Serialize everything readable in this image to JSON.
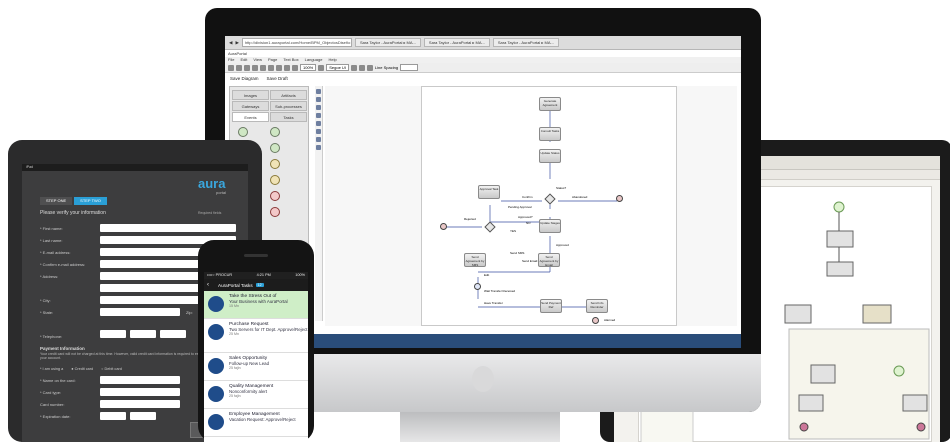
{
  "laptop": {
    "toolbar_label": "Line Spacing"
  },
  "monitor": {
    "browser": {
      "url": "http://division1.auraportal.com/Home/BPM_ObjectosDiseño",
      "tabs": [
        "Sara Taylor - AuraPortal ▸ MA...",
        "Sara Taylor - AuraPortal ▸ MA...",
        "Sara Taylor - AuraPortal ▸ MA..."
      ]
    },
    "app_title": "AuraPortal",
    "menu": [
      "File",
      "Edit",
      "View",
      "Page",
      "Text Box",
      "Language",
      "Help"
    ],
    "zoom": "100%",
    "font": "Segoe UI",
    "line_spacing_label": "Line Spacing",
    "save_diagram": "Save Diagram",
    "save_draft": "Save Draft",
    "palette_tabs": [
      "Images",
      "Artifacts",
      "Gateways",
      "Sub-processes",
      "Events",
      "Tasks"
    ],
    "nodes": {
      "n1": "Generate Agreement",
      "n2": "Consult Tasks",
      "n3": "Update Status",
      "n4": "Approval Task",
      "n5": "Update Stages",
      "n6": "Send Agreement by SMS",
      "n7": "Send Agreement by Email",
      "n8": "Send Payment Ref",
      "n9": "Send Info Reminder",
      "lbl_status": "Status?",
      "lbl_pending": "Pending Approval",
      "lbl_approved": "Approved?",
      "lbl_confirm": "Confirm",
      "lbl_no": "NO",
      "lbl_yes": "YES",
      "lbl_edit": "Edit",
      "lbl_rejected": "Rejected",
      "lbl_abandoned": "Abandoned",
      "lbl_approved2": "Approved",
      "lbl_send_sms": "Send SMS",
      "lbl_send_email": "Send Email",
      "lbl_wait": "Wait Transfer Received",
      "lbl_alarmed": "Alarmed",
      "lbl_transfer": "Have Transfer"
    }
  },
  "tablet": {
    "status": "iPad",
    "steps": [
      "STEP ONE",
      "STEP TWO"
    ],
    "brand": "aura",
    "brand_sub": "portal",
    "form_heading": "Please verify your information",
    "required": "Required fields",
    "fields": [
      "* First name:",
      "* Last name:",
      "* E-mail address:",
      "* Confirm e-mail address:",
      "* Address:",
      "* City:",
      "* State:"
    ],
    "zip": "Zip:",
    "telephone": "* Telephone:",
    "payment_heading": "Payment Information",
    "payment_text": "Your credit card will not be charged at this time. However, valid credit card information is required to establish your account.",
    "payment_method_label": "* I am using a",
    "credit_card": "Credit card",
    "debit_card": "Debit card",
    "card_fields": [
      "* Name on the card:",
      "* Card type:",
      "Card number:",
      "* Expiration date:"
    ],
    "submit": "SUBMIT YOUR INFORMATION"
  },
  "phone": {
    "carrier": "••••○ PROCUR",
    "time": "4:21 PM",
    "battery": "100%",
    "header": "AuraPortal Tasks",
    "header_badge": "12",
    "tasks": [
      {
        "title": "Take the Stress Out of",
        "sub": "Your Business with AuraPortal",
        "time": "15 Mn"
      },
      {
        "title": "Purchase Request",
        "sub": "Two Servers for IT Dept. Approve/Reject",
        "time": "25 Mn"
      },
      {
        "title": "Sales Opportunity",
        "sub": "Follow-up New Lead",
        "time": "25 fajln"
      },
      {
        "title": "Quality Management",
        "sub": "Nonconformity alert",
        "time": "25 fajln"
      },
      {
        "title": "Employee Management",
        "sub": "Vacation Request: Approve/Reject",
        "time": ""
      }
    ]
  },
  "colors": {
    "accent": "#2a9fd6",
    "taskbar": "#2a4d7a",
    "highlight_task": "#cfeec7"
  }
}
